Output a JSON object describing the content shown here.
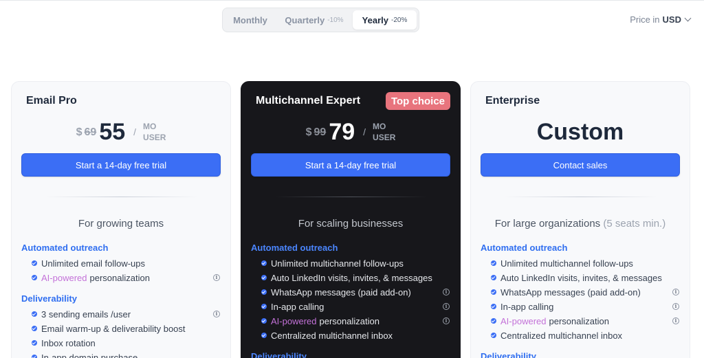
{
  "billing": {
    "options": [
      {
        "label": "Monthly",
        "discount": ""
      },
      {
        "label": "Quarterly",
        "discount": "-10%"
      },
      {
        "label": "Yearly",
        "discount": "-20%"
      }
    ],
    "selected": "Yearly"
  },
  "currency": {
    "prefix": "Price in",
    "code": "USD"
  },
  "plans": [
    {
      "name": "Email Pro",
      "currency_symbol": "$",
      "old_price": "69",
      "price": "55",
      "unit": [
        "MO",
        "USER"
      ],
      "cta": "Start a 14-day free trial",
      "tagline": "For growing teams",
      "sections": [
        {
          "title": "Automated outreach",
          "features": [
            {
              "text": "Unlimited email follow-ups"
            },
            {
              "ai": "AI-powered",
              "text": "personalization",
              "info": "i"
            }
          ]
        },
        {
          "title": "Deliverability",
          "features": [
            {
              "text": "3 sending emails /user",
              "info": "i"
            },
            {
              "text": "Email warm-up & deliverability boost"
            },
            {
              "text": "Inbox rotation"
            },
            {
              "text": "In-app domain purchase"
            }
          ]
        }
      ]
    },
    {
      "name": "Multichannel Expert",
      "badge": "Top choice",
      "currency_symbol": "$",
      "old_price": "99",
      "price": "79",
      "unit": [
        "MO",
        "USER"
      ],
      "cta": "Start a 14-day free trial",
      "tagline": "For scaling businesses",
      "sections": [
        {
          "title": "Automated outreach",
          "features": [
            {
              "text": "Unlimited multichannel follow-ups"
            },
            {
              "text": "Auto LinkedIn visits, invites, & messages"
            },
            {
              "text": "WhatsApp messages (paid add-on)",
              "info": "i"
            },
            {
              "text": "In-app calling",
              "info": "i"
            },
            {
              "ai": "AI-powered",
              "text": "personalization",
              "info": "i"
            },
            {
              "text": "Centralized multichannel inbox"
            }
          ]
        },
        {
          "title": "Deliverability",
          "features": []
        }
      ]
    },
    {
      "name": "Enterprise",
      "custom_price": "Custom",
      "cta": "Contact sales",
      "tagline": "For large organizations",
      "tagline_note": "(5 seats min.)",
      "sections": [
        {
          "title": "Automated outreach",
          "features": [
            {
              "text": "Unlimited multichannel follow-ups"
            },
            {
              "text": "Auto LinkedIn visits, invites, & messages"
            },
            {
              "text": "WhatsApp messages (paid add-on)",
              "info": "i"
            },
            {
              "text": "In-app calling",
              "info": "i"
            },
            {
              "ai": "AI-powered",
              "text": "personalization",
              "info": "i"
            },
            {
              "text": "Centralized multichannel inbox"
            }
          ]
        },
        {
          "title": "Deliverability",
          "features": []
        }
      ]
    }
  ],
  "colors": {
    "accent": "#3b6ef5",
    "badge": "#e8747d",
    "ai": "#c371d8",
    "dark_card": "#17171b"
  }
}
